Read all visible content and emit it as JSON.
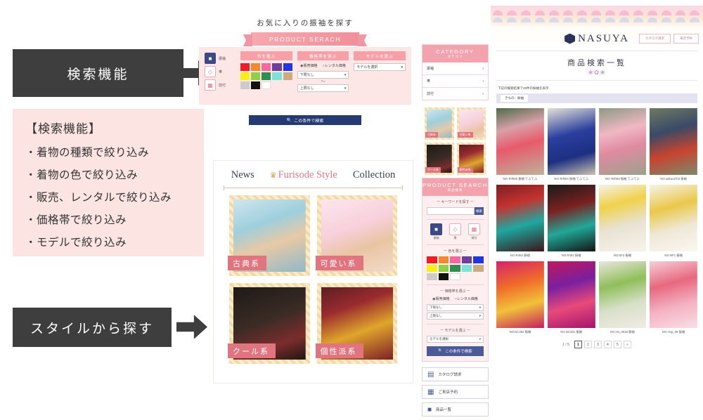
{
  "left": {
    "box1_label": "検索機能",
    "box2_label": "スタイルから探す",
    "info_title": "【検索機能】",
    "info_items": [
      "・着物の種類で絞り込み",
      "・着物の色で絞り込み",
      "・販売、レンタルで絞り込み",
      "・価格帯で絞り込み",
      "・モデルで絞り込み"
    ]
  },
  "search_module": {
    "subtitle": "お気に入りの振袖を探す",
    "ribbon": "PRODUCT SERACH",
    "categories": [
      {
        "label": "振袖",
        "icon": "kimono-icon",
        "selected": true
      },
      {
        "label": "帯",
        "icon": "obi-icon",
        "selected": false
      },
      {
        "label": "前付",
        "icon": "accessory-icon",
        "selected": false
      }
    ],
    "color_header": "色を選ぶ",
    "colors": [
      "#ef1c24",
      "#f08a2a",
      "#f4689f",
      "#6a3f9e",
      "#1f36e0",
      "#f7ef16",
      "#8ed04a",
      "#2f8f4e",
      "#7de3d8",
      "#cbab80",
      "#cccccc",
      "#111111",
      "#ffffff"
    ],
    "price_header": "価格帯を選ぶ",
    "radio_sale": "販売価格",
    "radio_rental": "レンタル価格",
    "price_min": "下限なし",
    "price_max": "上限なし",
    "tilde": "〜",
    "model_header": "モデルを選ぶ",
    "model_value": "モデルを選択",
    "search_button": "この条件で検索"
  },
  "style_module": {
    "nav": [
      "News",
      "Furisode Style",
      "Collection"
    ],
    "active_nav": "Furisode Style",
    "cards": [
      {
        "label": "古典系"
      },
      {
        "label": "可愛い系"
      },
      {
        "label": "クール系"
      },
      {
        "label": "個性派系"
      }
    ]
  },
  "site": {
    "brand": "NASUYA",
    "header_buttons": [
      "カタログ請求",
      "来店予約"
    ],
    "page_title": "商品検索一覧",
    "result_line": "下記の検索結果で40件の振袖を表示",
    "filter_chip": "きもの：振袖",
    "sidebar": {
      "category": {
        "title": "CATEGORY",
        "sub": "カテゴリ",
        "items": [
          "振袖",
          "帯",
          "前付"
        ]
      },
      "thumbs": [
        {
          "label": "古典系"
        },
        {
          "label": "可愛い系"
        },
        {
          "label": "クール系"
        },
        {
          "label": "個性派系"
        }
      ],
      "product_search": {
        "title": "PRODUCT SEARCH",
        "sub": "商品検索"
      },
      "keyword_label": "ー キーワードを探す ー",
      "keyword_placeholder": "",
      "keyword_button": "検索",
      "cat3": [
        {
          "label": "振袖",
          "selected": true
        },
        {
          "label": "帯",
          "selected": false
        },
        {
          "label": "前付",
          "selected": false
        }
      ],
      "color_label": "ー 色を選ぶ ー",
      "price_label": "ー 価格帯を選ぶ ー",
      "radio_sale": "販売価格",
      "radio_rental": "レンタル価格",
      "price_min": "下限なし",
      "price_max": "上限なし",
      "model_label": "ー モデルを選ぶ ー",
      "model_value": "モデルを選択",
      "search_button": "この条件で検索",
      "links": [
        {
          "label": "カタログ請求",
          "icon": "catalog-icon"
        },
        {
          "label": "ご来店予約",
          "icon": "calendar-icon"
        },
        {
          "label": "商品一覧",
          "icon": "list-icon"
        }
      ]
    },
    "products": [
      {
        "caption": "NO.Tef005 振袖 てふてふ"
      },
      {
        "caption": "NO.Tef004 振袖 てふてふ"
      },
      {
        "caption": "NO.Tef003 振袖 てふてふ"
      },
      {
        "caption": "NO.sakura703 振袖"
      },
      {
        "caption": "NO.R453 振袖"
      },
      {
        "caption": "NO.R451 振袖"
      },
      {
        "caption": "NO.NF2 振袖"
      },
      {
        "caption": "NO.NF1 振袖"
      },
      {
        "caption": "NO.NC302 振袖"
      },
      {
        "caption": "NO.NC301 振袖"
      },
      {
        "caption": "NO.Hv_0018 振袖"
      },
      {
        "caption": "NO.Hcp_09 振袖"
      }
    ],
    "pagination": {
      "count": "1 / 5",
      "pages": [
        "1",
        "2",
        "3",
        "4",
        "5",
        "»"
      ],
      "current": "1"
    }
  }
}
